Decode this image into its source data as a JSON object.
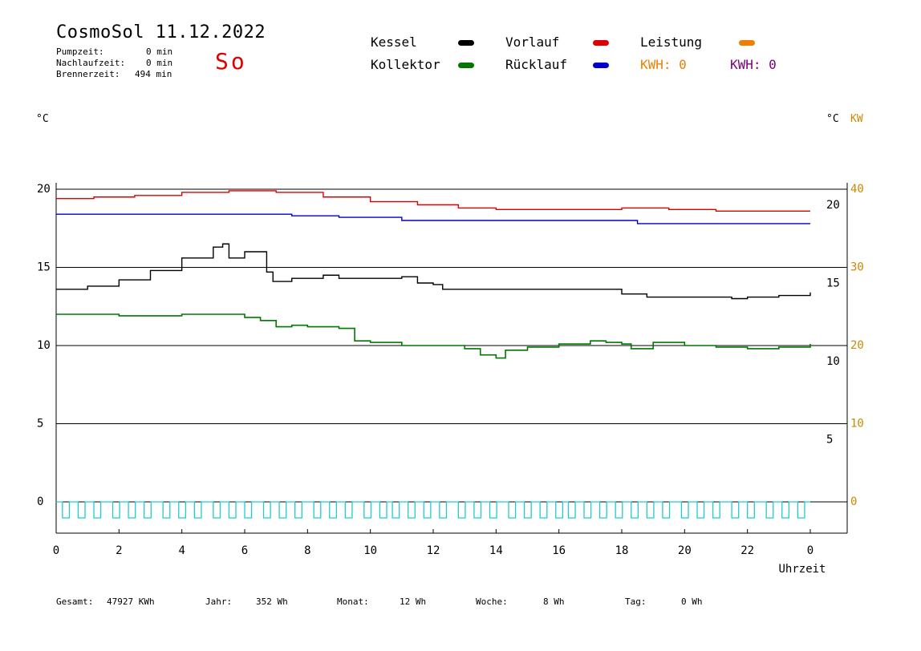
{
  "header": {
    "title": "CosmoSol 11.12.2022",
    "pump_label": "Pumpzeit:",
    "pump_value": "0 min",
    "afterrun_label": "Nachlaufzeit:",
    "afterrun_value": "0 min",
    "burner_label": "Brennerzeit:",
    "burner_value": "494 min",
    "day_status": "So"
  },
  "legend": {
    "kessel": "Kessel",
    "kollektor": "Kollektor",
    "vorlauf": "Vorlauf",
    "ruecklauf": "Rücklauf",
    "leistung": "Leistung",
    "kwh_a": "KWH: 0",
    "kwh_b": "KWH: 0"
  },
  "units": {
    "left": "°C",
    "right_temp": "°C",
    "right_kw": "KW"
  },
  "colors": {
    "kessel": "#000000",
    "kollektor": "#007700",
    "vorlauf": "#dd0000",
    "ruecklauf": "#0000cc",
    "leistung": "#ee8000",
    "kwh_b": "#800080",
    "pump": "#22cccc",
    "kw_axis": "#cc8800"
  },
  "footer": {
    "gesamt_label": "Gesamt:",
    "gesamt_value": "47927 KWh",
    "jahr_label": "Jahr:",
    "jahr_value": "352 Wh",
    "monat_label": "Monat:",
    "monat_value": "12 Wh",
    "woche_label": "Woche:",
    "woche_value": "8 Wh",
    "tag_label": "Tag:",
    "tag_value": "0 Wh"
  },
  "chart_data": {
    "type": "line",
    "xlabel": "Uhrzeit",
    "x_ticks": [
      "0",
      "2",
      "4",
      "6",
      "8",
      "10",
      "12",
      "14",
      "16",
      "18",
      "20",
      "22",
      "0"
    ],
    "xlim": [
      0,
      24
    ],
    "y_left_ticks": [
      20,
      15,
      10,
      5,
      0
    ],
    "y_right_temp_ticks": [
      20,
      15,
      10,
      5
    ],
    "y_right_kw_ticks": [
      40,
      30,
      20,
      10,
      0
    ],
    "ylim": [
      0,
      20
    ],
    "grid": "horizontal",
    "series": [
      {
        "name": "Vorlauf",
        "color": "#dd0000",
        "x": [
          0,
          1.2,
          2.5,
          4,
          5.5,
          7,
          8.5,
          10,
          11.5,
          12.8,
          14,
          16,
          17.5,
          18,
          19.5,
          21,
          22.5,
          24
        ],
        "y": [
          19.4,
          19.5,
          19.6,
          19.8,
          19.9,
          19.8,
          19.5,
          19.2,
          19.0,
          18.8,
          18.7,
          18.7,
          18.7,
          18.8,
          18.7,
          18.6,
          18.6,
          18.6
        ]
      },
      {
        "name": "Rücklauf",
        "color": "#0000cc",
        "x": [
          0,
          2,
          4,
          6,
          7.5,
          9,
          11,
          12.5,
          15,
          18.5,
          20,
          22,
          24
        ],
        "y": [
          18.4,
          18.4,
          18.4,
          18.4,
          18.3,
          18.2,
          18.0,
          18.0,
          18.0,
          17.8,
          17.8,
          17.8,
          17.8
        ]
      },
      {
        "name": "Kessel",
        "color": "#000000",
        "x": [
          0,
          1,
          2,
          3,
          4,
          5,
          5.3,
          5.5,
          6,
          6.5,
          6.7,
          6.9,
          7.5,
          8.5,
          9,
          10,
          11,
          11.5,
          12,
          12.3,
          13,
          14,
          15,
          16,
          17,
          18,
          18.8,
          20,
          21,
          21.5,
          22,
          23,
          24
        ],
        "y": [
          13.6,
          13.8,
          14.2,
          14.8,
          15.6,
          16.3,
          16.5,
          15.6,
          16.0,
          16.0,
          14.7,
          14.1,
          14.3,
          14.5,
          14.3,
          14.3,
          14.4,
          14.0,
          13.9,
          13.6,
          13.6,
          13.6,
          13.6,
          13.6,
          13.6,
          13.3,
          13.1,
          13.1,
          13.1,
          13.0,
          13.1,
          13.2,
          13.4
        ]
      },
      {
        "name": "Kollektor",
        "color": "#007700",
        "x": [
          0,
          1,
          2,
          3,
          4,
          5,
          6,
          6.5,
          7,
          7.5,
          8,
          9,
          9.5,
          10,
          11,
          12,
          13,
          13.5,
          14,
          14.3,
          15,
          16,
          17,
          17.5,
          18,
          18.3,
          19,
          20,
          21,
          22,
          23,
          24
        ],
        "y": [
          12.0,
          12.0,
          11.9,
          11.9,
          12.0,
          12.0,
          11.8,
          11.6,
          11.2,
          11.3,
          11.2,
          11.1,
          10.3,
          10.2,
          10.0,
          10.0,
          9.8,
          9.4,
          9.2,
          9.7,
          9.9,
          10.1,
          10.3,
          10.2,
          10.1,
          9.8,
          10.2,
          10.0,
          9.9,
          9.8,
          9.9,
          10.1
        ]
      },
      {
        "name": "Pumpe",
        "color": "#22cccc",
        "type": "pulses",
        "x": [
          0.2,
          0.7,
          1.2,
          1.8,
          2.3,
          2.8,
          3.4,
          3.9,
          4.4,
          5.0,
          5.5,
          6.0,
          6.6,
          7.1,
          7.6,
          8.2,
          8.7,
          9.2,
          9.8,
          10.3,
          10.7,
          11.2,
          11.7,
          12.2,
          12.8,
          13.3,
          13.8,
          14.4,
          14.9,
          15.4,
          15.9,
          16.3,
          16.8,
          17.3,
          17.8,
          18.3,
          18.8,
          19.3,
          19.9,
          20.4,
          20.9,
          21.5,
          22.0,
          22.6,
          23.1,
          23.6
        ],
        "low": 0.0,
        "high": -0.9
      }
    ]
  }
}
